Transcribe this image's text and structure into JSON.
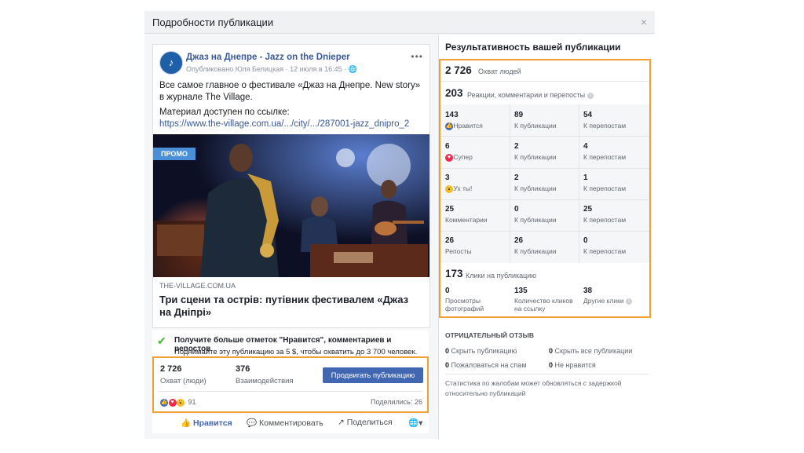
{
  "modal": {
    "title": "Подробности публикации",
    "close_symbol": "×"
  },
  "post": {
    "page_name": "Джаз на Днепре - Jazz on the Dnieper",
    "published_by": "Опубликовано Юля Белицкая",
    "date": "· 12 июля в 16:45 ·",
    "text1": "Все самое главное о фестивале «Джаз на Днепре. New story» в журнале The Village.",
    "text2": "Материал доступен по ссылке:",
    "link": "https://www.the-village.com.ua/.../city/.../287001-jazz_dnipro_2",
    "promo_badge": "ПРОМО",
    "link_domain": "THE-VILLAGE.COM.UA",
    "link_title": "Три сцени та острів: путівник фестивалем «Джаз на Дніпрі»"
  },
  "boost": {
    "title": "Получите больше отметок \"Нравится\", комментариев и репостов",
    "subtitle": "Поднимайте эту публикацию за 5 $, чтобы охватить до 3 700 человек."
  },
  "post_stats": {
    "reach_value": "2 726",
    "reach_label": "Охват (люди)",
    "engagement_value": "376",
    "engagement_label": "Взаимодействия",
    "promote_button": "Продвигать публикацию",
    "reactions_count": "91",
    "shares": "Поделились: 26"
  },
  "actions": {
    "like": "Нравится",
    "comment": "Комментировать",
    "share": "Поделиться"
  },
  "performance": {
    "title": "Результативность вашей публикации",
    "reach_value": "2 726",
    "reach_label": "Охват людей",
    "reactions_value": "203",
    "reactions_label": "Реакции, комментарии и перепосты",
    "rows": [
      {
        "total": "143",
        "label": "Нравится",
        "on_post": "89",
        "on_post_label": "К публикации",
        "on_shares": "54",
        "on_shares_label": "К перепостам"
      },
      {
        "total": "6",
        "label": "Супер",
        "on_post": "2",
        "on_post_label": "К публикации",
        "on_shares": "4",
        "on_shares_label": "К перепостам"
      },
      {
        "total": "3",
        "label": "Ух ты!",
        "on_post": "2",
        "on_post_label": "К публикации",
        "on_shares": "1",
        "on_shares_label": "К перепостам"
      },
      {
        "total": "25",
        "label": "Комментарии",
        "on_post": "0",
        "on_post_label": "К публикации",
        "on_shares": "25",
        "on_shares_label": "К перепостам"
      },
      {
        "total": "26",
        "label": "Репосты",
        "on_post": "26",
        "on_post_label": "К публикации",
        "on_shares": "0",
        "on_shares_label": "К перепостам"
      }
    ],
    "clicks_value": "173",
    "clicks_label": "Клики на публикацию",
    "photo_views_value": "0",
    "photo_views_label_1": "Просмотры",
    "photo_views_label_2": "фотографий",
    "link_clicks_value": "135",
    "link_clicks_label_1": "Количество кликов",
    "link_clicks_label_2": "на ссылку",
    "other_clicks_value": "38",
    "other_clicks_label": "Другие клики",
    "negative_title": "ОТРИЦАТЕЛЬНЫЙ ОТЗЫВ",
    "hide_post_value": "0",
    "hide_post_label": "Скрыть публикацию",
    "hide_all_value": "0",
    "hide_all_label": "Скрыть все публикации",
    "spam_value": "0",
    "spam_label": "Пожаловаться на спам",
    "unlike_value": "0",
    "unlike_label": "Не нравится",
    "footnote": "Статистика по жалобам может обновляться с задержкой относительно публикаций"
  },
  "colors": {
    "accent": "#4267b2",
    "highlight": "#f0a030",
    "link": "#385898"
  },
  "icons": [
    "close-icon",
    "page-avatar-icon",
    "globe-icon",
    "more-icon",
    "check-icon",
    "like-reaction-icon",
    "love-reaction-icon",
    "wow-reaction-icon",
    "thumbs-up-icon",
    "comment-icon",
    "share-icon",
    "info-icon"
  ]
}
